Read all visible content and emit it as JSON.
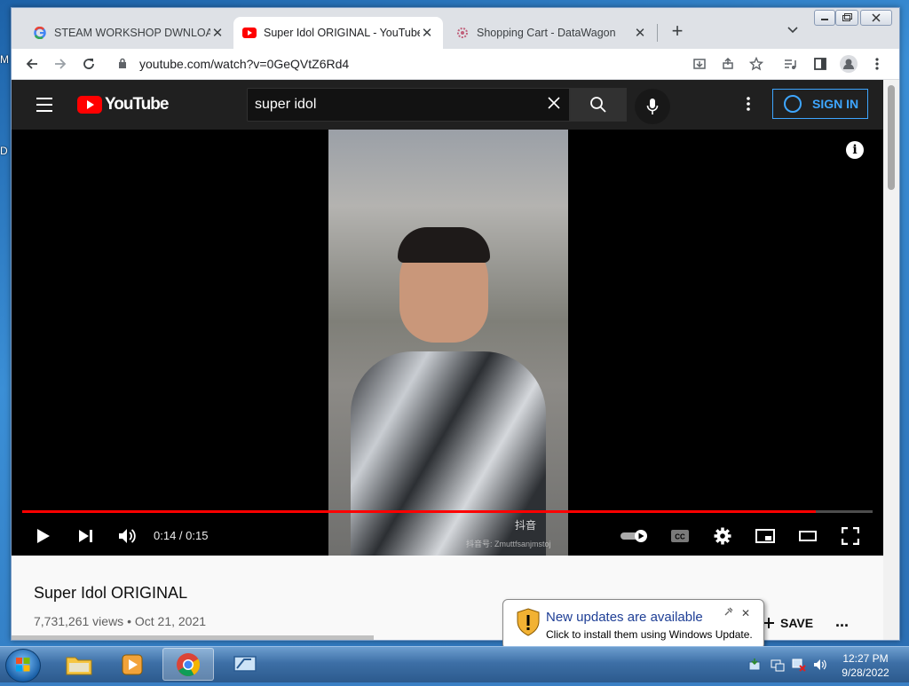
{
  "desktop": {
    "fragment_top": "M",
    "fragment_mid": "D"
  },
  "tabs": [
    {
      "title": "STEAM WORKSHOP DWNLOADE",
      "close": "✕",
      "favicon": "google-icon"
    },
    {
      "title": "Super Idol ORIGINAL - YouTube",
      "close": "✕",
      "favicon": "youtube-icon"
    },
    {
      "title": "Shopping Cart - DataWagon",
      "close": "✕",
      "favicon": "datawagon-icon"
    }
  ],
  "new_tab_label": "+",
  "address": {
    "url": "youtube.com/watch?v=0GeQVtZ6Rd4"
  },
  "youtube": {
    "logo_text": "YouTube",
    "search_value": "super idol",
    "sign_in": "SIGN IN"
  },
  "player": {
    "time": "0:14 / 0:15",
    "progress": 0.933,
    "watermark": "抖音",
    "watermark_id": "抖音号: Zmuttfsanjmstoj"
  },
  "video": {
    "title": "Super Idol ORIGINAL",
    "meta": "7,731,261 views • Oct 21, 2021",
    "save_label": "SAVE",
    "more_label": "..."
  },
  "notification": {
    "title": "New updates are available",
    "message": "Click to install them using Windows Update.",
    "close": "✕"
  },
  "clock": {
    "time": "12:27 PM",
    "date": "9/28/2022"
  },
  "colors": {
    "yt_red": "#ff0000",
    "signin_blue": "#3ea6ff",
    "balloon_title": "#1f3f96"
  }
}
